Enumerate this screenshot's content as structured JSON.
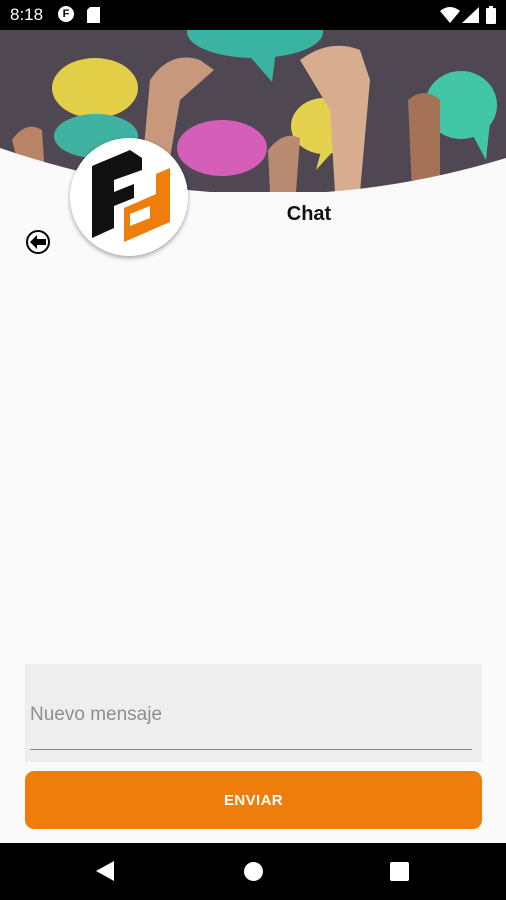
{
  "status_bar": {
    "time": "8:18",
    "icons": [
      "notification-f-icon",
      "sd-card-icon",
      "wifi-icon",
      "signal-icon",
      "battery-icon"
    ]
  },
  "header": {
    "title": "Chat",
    "banner_image": "hands-holding-speech-bubbles",
    "logo": "fd-logo"
  },
  "composer": {
    "placeholder": "Nuevo mensaje",
    "value": "",
    "send_label": "ENVIAR"
  },
  "nav_bar": {
    "buttons": [
      "back",
      "home",
      "recents"
    ]
  },
  "colors": {
    "accent": "#ef7d0b",
    "background": "#fafafa",
    "input_background": "#eeeeee"
  }
}
